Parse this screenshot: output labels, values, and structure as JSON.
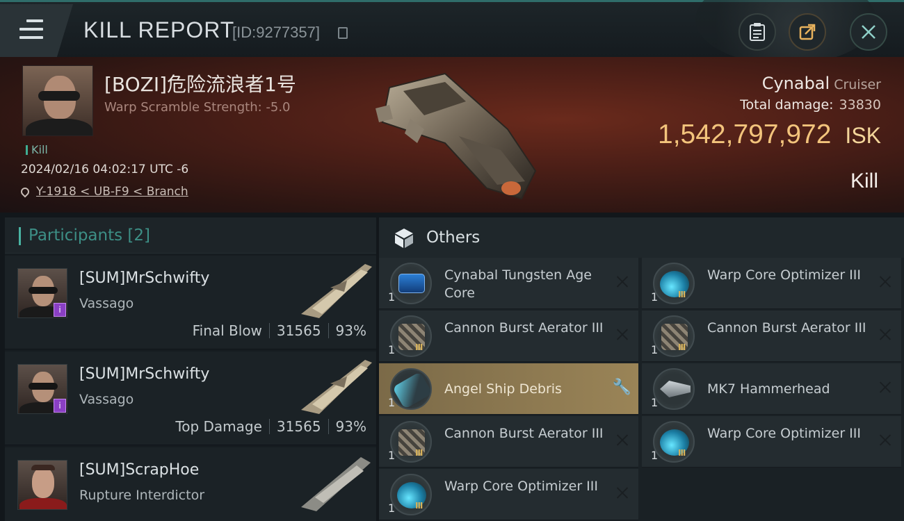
{
  "header": {
    "title": "KILL REPORT",
    "report_id": "[ID:9277357]"
  },
  "victim": {
    "name": "[BOZI]危险流浪者1号",
    "warp_scramble": "Warp Scramble Strength: -5.0",
    "kill_tag": "Kill",
    "timestamp": "2024/02/16 04:02:17 UTC -6",
    "location": "Y-1918 < UB-F9 < Branch",
    "ship_name": "Cynabal",
    "ship_class": "Cruiser",
    "damage_label": "Total damage:",
    "damage_value": "33830",
    "isk_value": "1,542,797,972",
    "isk_unit": "ISK",
    "result": "Kill"
  },
  "participants": {
    "label": "Participants [2]",
    "rows": [
      {
        "name": "[SUM]MrSchwifty",
        "ship": "Vassago",
        "role": "Final Blow",
        "damage": "31565",
        "percent": "93%",
        "badge": "i"
      },
      {
        "name": "[SUM]MrSchwifty",
        "ship": "Vassago",
        "role": "Top Damage",
        "damage": "31565",
        "percent": "93%",
        "badge": "i"
      },
      {
        "name": "[SUM]ScrapHoe",
        "ship": "Rupture Interdictor"
      }
    ]
  },
  "others": {
    "label": "Others",
    "items": [
      {
        "name": "Cynabal Tungsten Age Core",
        "qty": "1",
        "icon": "core-icon"
      },
      {
        "name": "Warp Core Optimizer III",
        "qty": "1",
        "tier": "III",
        "icon": "optimizer-icon"
      },
      {
        "name": "Cannon Burst Aerator III",
        "qty": "1",
        "tier": "III",
        "icon": "aerator-icon"
      },
      {
        "name": "Cannon Burst Aerator III",
        "qty": "1",
        "tier": "III",
        "icon": "aerator-icon"
      },
      {
        "name": "Angel Ship Debris",
        "qty": "1",
        "icon": "debris-icon"
      },
      {
        "name": "MK7 Hammerhead",
        "qty": "1",
        "icon": "drone-icon"
      },
      {
        "name": "Cannon Burst Aerator III",
        "qty": "1",
        "tier": "III",
        "icon": "aerator-icon"
      },
      {
        "name": "Warp Core Optimizer III",
        "qty": "1",
        "tier": "III",
        "icon": "optimizer-icon"
      },
      {
        "name": "Warp Core Optimizer III",
        "qty": "1",
        "tier": "III",
        "icon": "optimizer-icon"
      }
    ]
  },
  "colors": {
    "accent_teal": "#49b4a3",
    "isk_gold": "#f3c47c",
    "highlight": "#9a8457"
  }
}
